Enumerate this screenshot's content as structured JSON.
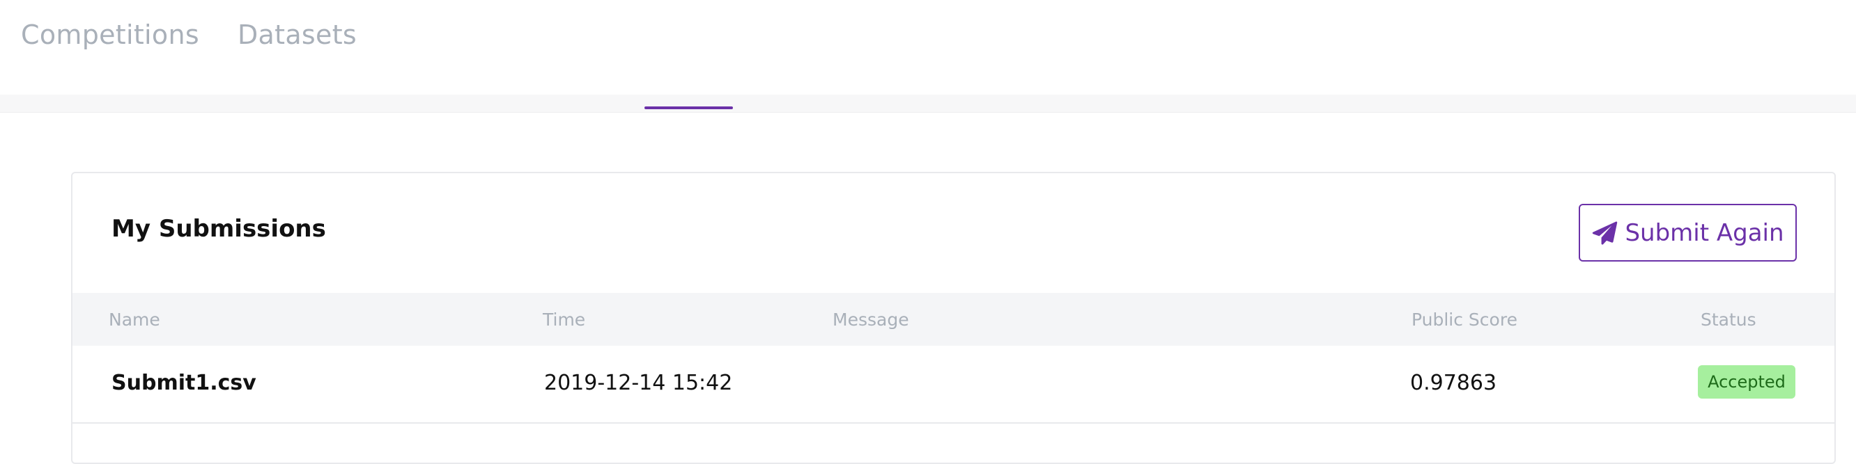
{
  "nav": {
    "items": [
      "Competitions",
      "Datasets"
    ]
  },
  "submissions": {
    "title": "My Submissions",
    "submit_again_label": "Submit Again",
    "columns": [
      "Name",
      "Time",
      "Message",
      "Public Score",
      "Status"
    ],
    "rows": [
      {
        "name": "Submit1.csv",
        "time": "2019-12-14 15:42",
        "message": "",
        "public_score": "0.97863",
        "status": "Accepted"
      }
    ]
  },
  "colors": {
    "accent": "#6b31a8",
    "nav_text": "#a9b0b9",
    "status_accepted_bg": "#a6ef9e",
    "status_accepted_text": "#1e6b1a"
  },
  "icons": {
    "submit_again": "paper-plane-icon"
  }
}
